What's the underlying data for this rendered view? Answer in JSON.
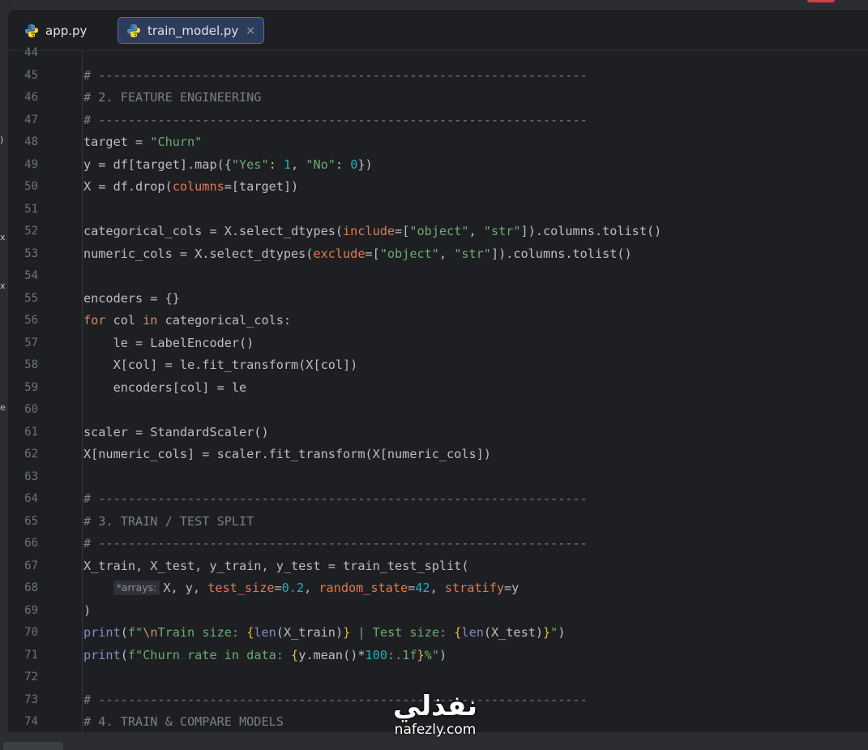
{
  "tabs": [
    {
      "label": "app.py",
      "active": false
    },
    {
      "label": "train_model.py",
      "active": true,
      "close": "×"
    }
  ],
  "code": {
    "line_numbers": [
      "44",
      "45",
      "46",
      "47",
      "48",
      "49",
      "50",
      "51",
      "52",
      "53",
      "54",
      "55",
      "56",
      "57",
      "58",
      "59",
      "60",
      "61",
      "62",
      "63",
      "64",
      "65",
      "66",
      "67",
      "68",
      "69",
      "70",
      "71",
      "72",
      "73",
      "74"
    ],
    "comment_rule": "# ------------------------------------------------------------------",
    "section_2": "# 2. FEATURE ENGINEERING",
    "section_3": "# 3. TRAIN / TEST SPLIT",
    "section_4": "# 4. TRAIN & COMPARE MODELS",
    "inlay_hint": "*arrays:"
  },
  "watermark": {
    "arabic": "نفذلي",
    "latin": "nafezly.com"
  },
  "stray_glyphs": [
    ")",
    "x",
    "x",
    "e"
  ],
  "colors": {
    "background": "#1e1f22",
    "keyword": "#cf8e6d",
    "string": "#6aab73",
    "number": "#2aacb8",
    "comment": "#7a7e85",
    "param": "#e07b53",
    "active_tab": "#2e3c5b"
  }
}
